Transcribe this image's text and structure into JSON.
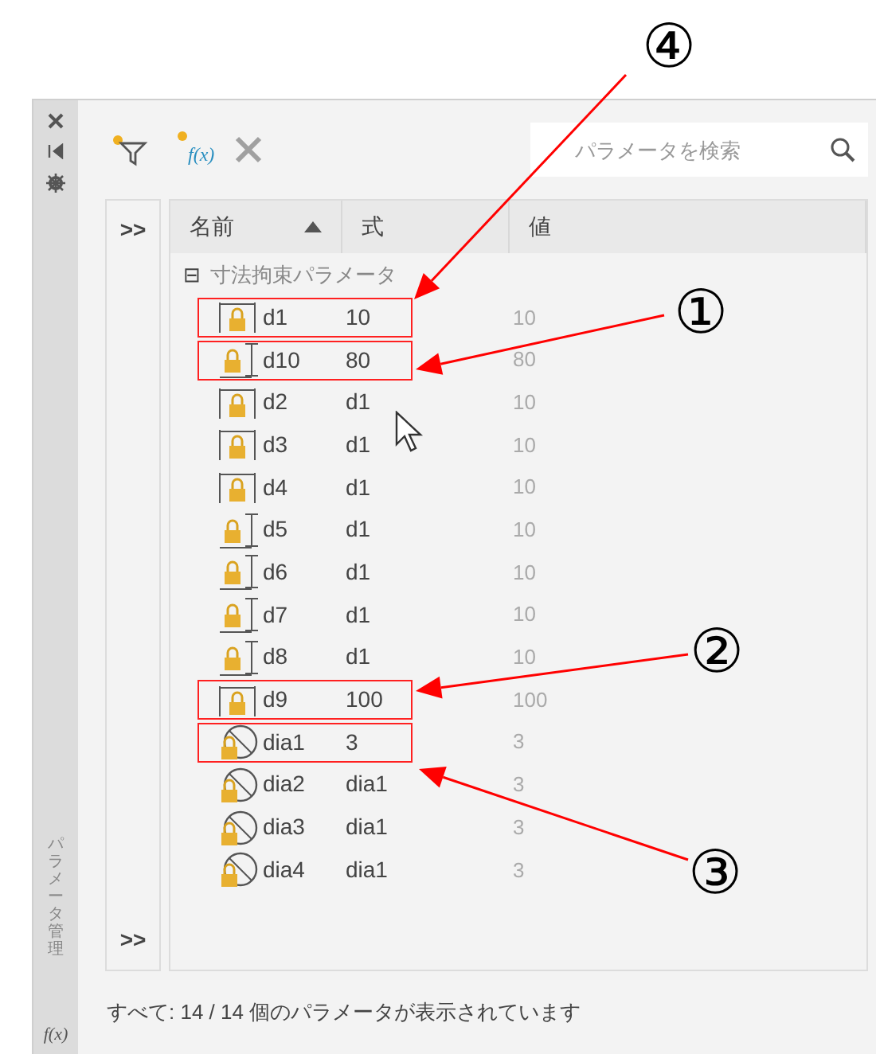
{
  "side_strip": {
    "vertical_title": "パラメータ管理",
    "function_label": "f(x)"
  },
  "toolbar": {
    "function_icon_label": "f(x)",
    "search": {
      "placeholder": "パラメータを検索"
    }
  },
  "table": {
    "columns": [
      {
        "label": "名前",
        "sorted": true
      },
      {
        "label": "式",
        "sorted": false
      },
      {
        "label": "値",
        "sorted": false
      }
    ],
    "group": {
      "label": "寸法拘束パラメータ",
      "expanded": true,
      "toggle": "⊟"
    },
    "rows": [
      {
        "kind": "linear",
        "name": "d1",
        "expression": "10",
        "value": "10",
        "boxed": true,
        "callout": "④"
      },
      {
        "kind": "vertical",
        "name": "d10",
        "expression": "80",
        "value": "80",
        "boxed": true,
        "callout": "①"
      },
      {
        "kind": "linear",
        "name": "d2",
        "expression": "d1",
        "value": "10",
        "boxed": false
      },
      {
        "kind": "linear",
        "name": "d3",
        "expression": "d1",
        "value": "10",
        "boxed": false
      },
      {
        "kind": "linear",
        "name": "d4",
        "expression": "d1",
        "value": "10",
        "boxed": false
      },
      {
        "kind": "vertical",
        "name": "d5",
        "expression": "d1",
        "value": "10",
        "boxed": false
      },
      {
        "kind": "vertical",
        "name": "d6",
        "expression": "d1",
        "value": "10",
        "boxed": false
      },
      {
        "kind": "vertical",
        "name": "d7",
        "expression": "d1",
        "value": "10",
        "boxed": false
      },
      {
        "kind": "vertical",
        "name": "d8",
        "expression": "d1",
        "value": "10",
        "boxed": false
      },
      {
        "kind": "linear",
        "name": "d9",
        "expression": "100",
        "value": "100",
        "boxed": true,
        "callout": "②"
      },
      {
        "kind": "diameter",
        "name": "dia1",
        "expression": "3",
        "value": "3",
        "boxed": true,
        "callout": "③"
      },
      {
        "kind": "diameter",
        "name": "dia2",
        "expression": "dia1",
        "value": "3",
        "boxed": false
      },
      {
        "kind": "diameter",
        "name": "dia3",
        "expression": "dia1",
        "value": "3",
        "boxed": false
      },
      {
        "kind": "diameter",
        "name": "dia4",
        "expression": "dia1",
        "value": "3",
        "boxed": false
      }
    ]
  },
  "expand_left": ">>",
  "expand_right": ">>",
  "status_bar": "すべて: 14 / 14 個のパラメータが表示されています"
}
